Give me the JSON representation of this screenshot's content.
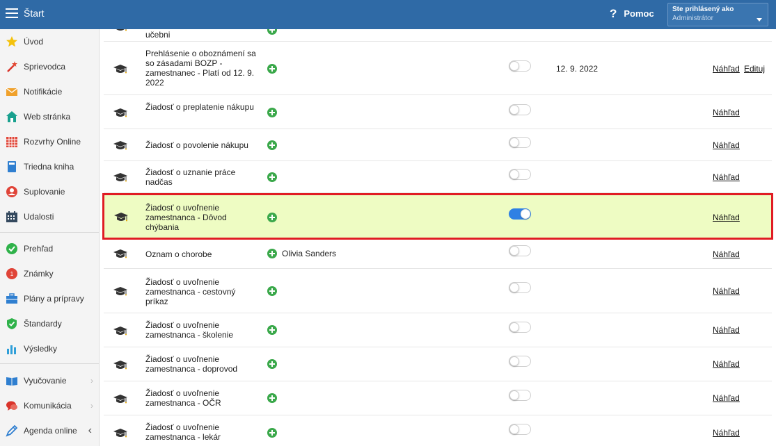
{
  "topbar": {
    "title": "Štart",
    "help_icon": "?",
    "help_label": "Pomoc",
    "user_line1": "Ste prihlásený ako",
    "user_line2": "Administrátor"
  },
  "colors": {
    "topbar": "#2f6aa6",
    "highlight_bg": "#eefcc3",
    "highlight_border": "#e01c24",
    "toggle_on": "#2f80e4",
    "plus_green": "#3aa84a"
  },
  "sidebar": {
    "items": [
      {
        "label": "Úvod",
        "icon": "star-icon"
      },
      {
        "label": "Sprievodca",
        "icon": "magic-wand-icon"
      },
      {
        "label": "Notifikácie",
        "icon": "envelope-icon"
      },
      {
        "label": "Web stránka",
        "icon": "home-icon"
      },
      {
        "label": "Rozvrhy Online",
        "icon": "grid-calendar-icon"
      },
      {
        "label": "Triedna kniha",
        "icon": "book-icon"
      },
      {
        "label": "Suplovanie",
        "icon": "user-substitute-icon"
      },
      {
        "label": "Udalosti",
        "icon": "calendar-icon"
      },
      {
        "label": "Prehľad",
        "icon": "check-circle-icon"
      },
      {
        "label": "Známky",
        "icon": "grade-icon"
      },
      {
        "label": "Plány a prípravy",
        "icon": "briefcase-icon"
      },
      {
        "label": "Štandardy",
        "icon": "shield-check-icon"
      },
      {
        "label": "Výsledky",
        "icon": "bar-chart-icon"
      },
      {
        "label": "Vyučovanie",
        "icon": "open-book-icon",
        "chevron": "›"
      },
      {
        "label": "Komunikácia",
        "icon": "chat-icon",
        "chevron": "›"
      },
      {
        "label": "Agenda online",
        "icon": "pen-icon",
        "chevron": "‹"
      }
    ]
  },
  "rows": [
    {
      "name": "učebni",
      "assignee": "",
      "toggle_on": false,
      "date": "",
      "preview": "",
      "edit": ""
    },
    {
      "name": "Prehlásenie o oboznámení sa so zásadami BOZP - zamestnanec - Platí od 12. 9. 2022",
      "assignee": "",
      "toggle_on": false,
      "date": "12. 9. 2022",
      "preview": "Náhľad",
      "edit": "Edituj"
    },
    {
      "name": "Žiadosť o preplatenie nákupu",
      "assignee": "",
      "toggle_on": false,
      "date": "",
      "preview": "Náhľad",
      "edit": ""
    },
    {
      "name": "Žiadosť o povolenie nákupu",
      "assignee": "",
      "toggle_on": false,
      "date": "",
      "preview": "Náhľad",
      "edit": ""
    },
    {
      "name": "Žiadosť o uznanie práce nadčas",
      "assignee": "",
      "toggle_on": false,
      "date": "",
      "preview": "Náhľad",
      "edit": ""
    },
    {
      "name": "Žiadosť o uvoľnenie zamestnanca - Dôvod chýbania",
      "assignee": "",
      "toggle_on": true,
      "date": "",
      "preview": "Náhľad",
      "edit": ""
    },
    {
      "name": "Oznam o chorobe",
      "assignee": "Olivia Sanders",
      "toggle_on": false,
      "date": "",
      "preview": "Náhľad",
      "edit": ""
    },
    {
      "name": "Žiadosť o uvoľnenie zamestnanca - cestovný príkaz",
      "assignee": "",
      "toggle_on": false,
      "date": "",
      "preview": "Náhľad",
      "edit": ""
    },
    {
      "name": "Žiadosť o uvoľnenie zamestnanca - školenie",
      "assignee": "",
      "toggle_on": false,
      "date": "",
      "preview": "Náhľad",
      "edit": ""
    },
    {
      "name": "Žiadosť o uvoľnenie zamestnanca - doprovod",
      "assignee": "",
      "toggle_on": false,
      "date": "",
      "preview": "Náhľad",
      "edit": ""
    },
    {
      "name": "Žiadosť o uvoľnenie zamestnanca - OČR",
      "assignee": "",
      "toggle_on": false,
      "date": "",
      "preview": "Náhľad",
      "edit": ""
    },
    {
      "name": "Žiadosť o uvoľnenie zamestnanca - lekár",
      "assignee": "",
      "toggle_on": false,
      "date": "",
      "preview": "Náhľad",
      "edit": ""
    }
  ]
}
